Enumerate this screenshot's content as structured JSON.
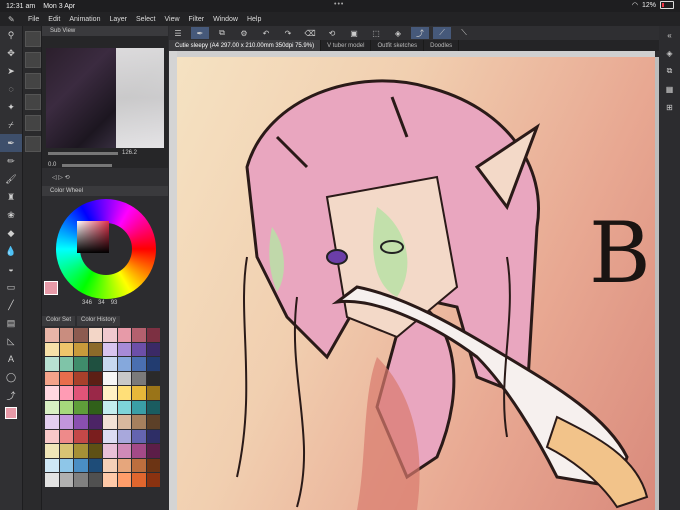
{
  "status": {
    "time": "12:31 am",
    "date": "Mon 3 Apr",
    "battery": "12%"
  },
  "menu": [
    "File",
    "Edit",
    "Animation",
    "Layer",
    "Select",
    "View",
    "Filter",
    "Window",
    "Help"
  ],
  "subview": {
    "title": "Sub View"
  },
  "navigator": {
    "zoom": "126.2",
    "angle": "0.0"
  },
  "color_wheel": {
    "title": "Color Wheel",
    "h": "346",
    "s": "34",
    "v": "93",
    "current_color": "#e79aa8"
  },
  "color_set": {
    "tabs": [
      "Color Set",
      "Color History"
    ]
  },
  "doc_tabs": [
    "Cutie sleepy (A4 297.00 x 210.00mm 350dpi 75.9%)",
    "V tuber model",
    "Outfit sketches",
    "Doodles"
  ],
  "canvas": {
    "letter": "B"
  },
  "palette": [
    "#e9b5a8",
    "#c98d7f",
    "#8c5b50",
    "#f3d6c7",
    "#f0c9cf",
    "#e79aa8",
    "#b4606e",
    "#7c3042",
    "#f6e0a8",
    "#efc56b",
    "#c89a3b",
    "#8c6a2a",
    "#d8c4ef",
    "#a78bd7",
    "#6c4fa8",
    "#3b2a66",
    "#b8e0d2",
    "#7fc4a8",
    "#3f8c6b",
    "#1f5040",
    "#c7d8f0",
    "#85a8dc",
    "#4a6fb0",
    "#223c70",
    "#f4a38a",
    "#e86d4c",
    "#a8402b",
    "#5c1f15",
    "#f6f6f6",
    "#c8c8c8",
    "#7a7a7a",
    "#2a2a2a",
    "#ffd7e0",
    "#ff9bb4",
    "#e05478",
    "#9a2848",
    "#fff1c4",
    "#ffdf78",
    "#e6b83a",
    "#9a7418",
    "#d9f0c4",
    "#a6d97c",
    "#5f9e3a",
    "#30601a",
    "#c4eef0",
    "#7ed4d9",
    "#3a9ea6",
    "#1a5c60",
    "#e4cff0",
    "#c295dc",
    "#8a4fb0",
    "#4c2466",
    "#f2e2d6",
    "#d8b89e",
    "#a6805e",
    "#5c4028",
    "#f8c8c8",
    "#ee8a8a",
    "#c44848",
    "#7a1e1e",
    "#dcdcf2",
    "#a8a8dc",
    "#6464b0",
    "#2e2e66",
    "#f0e6b8",
    "#d8c474",
    "#a69036",
    "#5e5014",
    "#e8c0d8",
    "#d08ab8",
    "#a44a88",
    "#5c1e48",
    "#cfe8f6",
    "#8ec6e8",
    "#4a8ec4",
    "#1e4c78",
    "#f4d0b8",
    "#e6a67c",
    "#bc6e3e",
    "#6c3414",
    "#e2e2e2",
    "#b0b0b0",
    "#808080",
    "#505050",
    "#ffc9a8",
    "#ff9d6a",
    "#e0662e",
    "#8a3210"
  ]
}
